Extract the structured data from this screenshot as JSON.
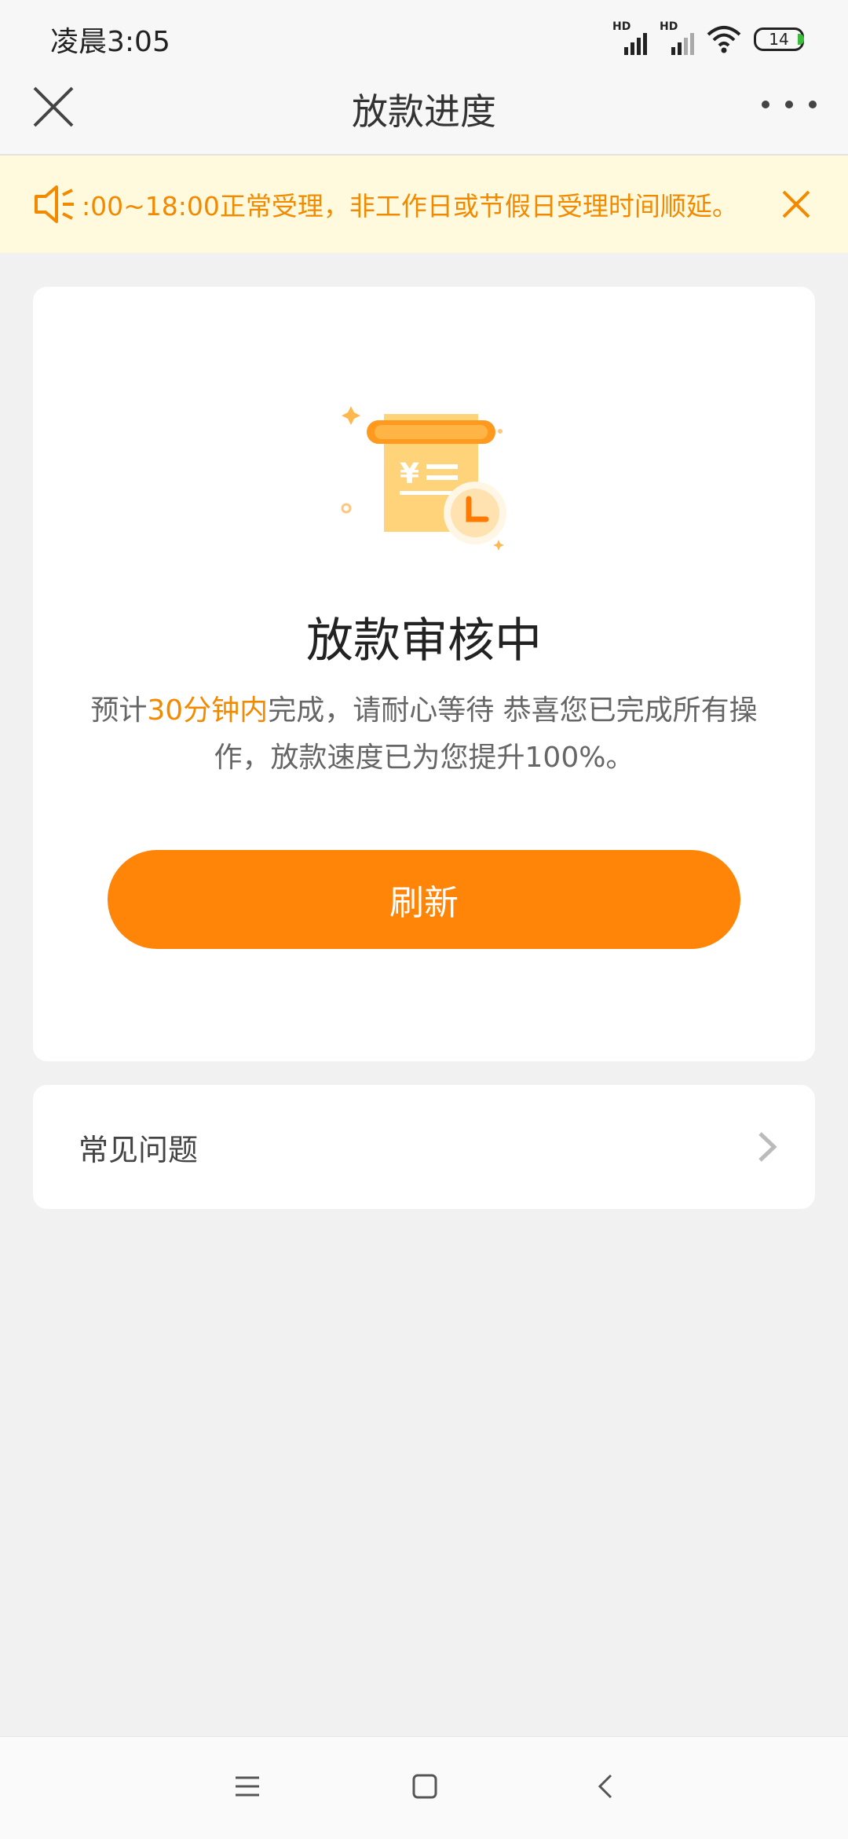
{
  "status_bar": {
    "time": "凌晨3:05",
    "signal1_label": "HD",
    "signal2_label": "HD",
    "battery_level": "14",
    "icons": [
      "signal-icon",
      "signal-icon",
      "wifi-icon",
      "battery-icon"
    ]
  },
  "nav": {
    "title": "放款进度",
    "left_icon": "close-icon",
    "right_icon": "more-icon"
  },
  "notice": {
    "icon": "speaker-icon",
    "text": ":00~18:00正常受理，非工作日或节假日受理时间顺延。",
    "close_icon": "close-icon"
  },
  "status_card": {
    "illustration": "receipt-clock-illustration",
    "title": "放款审核中",
    "desc_prefix": "预计",
    "desc_highlight": "30分钟内",
    "desc_suffix": "完成，请耐心等待 恭喜您已完成所有操作，放款速度已为您提升100%。",
    "refresh_label": "刷新"
  },
  "faq": {
    "label": "常见问题",
    "icon": "chevron-right-icon"
  },
  "system_nav": {
    "icons": [
      "menu-icon",
      "home-icon",
      "back-icon"
    ]
  },
  "colors": {
    "accent": "#ff8508",
    "notice_bg": "#fff9dd",
    "notice_text": "#f28a00",
    "page_bg": "#f1f1f1"
  }
}
